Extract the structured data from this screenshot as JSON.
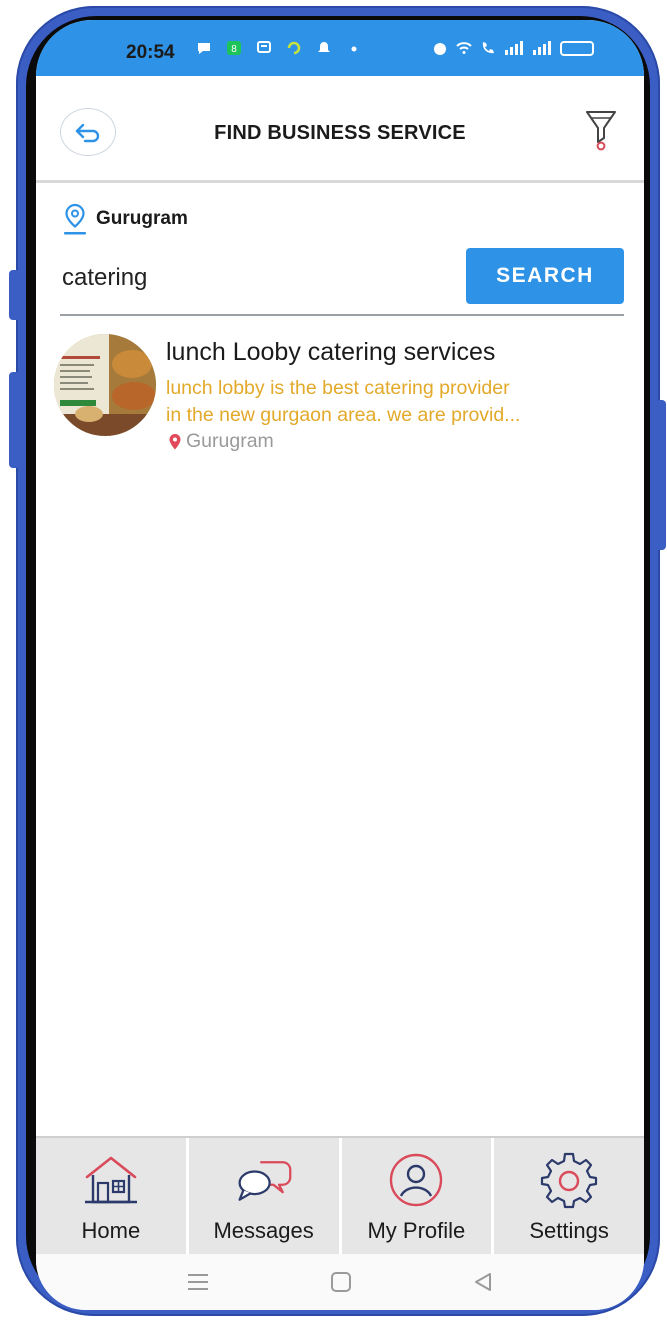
{
  "status_bar": {
    "time": "20:54"
  },
  "header": {
    "title": "FIND BUSINESS SERVICE",
    "back_icon": "back-arrow-icon",
    "filter_icon": "filter-icon"
  },
  "search": {
    "location": "Gurugram",
    "query": "catering",
    "button_label": "SEARCH"
  },
  "results": [
    {
      "title": "lunch Looby catering services",
      "description_line1": "lunch lobby is the best catering provider",
      "description_line2": "in the new gurgaon area. we are provid...",
      "location": "Gurugram"
    }
  ],
  "bottom_nav": {
    "items": [
      {
        "label": "Home",
        "icon": "home-icon"
      },
      {
        "label": "Messages",
        "icon": "messages-icon"
      },
      {
        "label": "My Profile",
        "icon": "profile-icon"
      },
      {
        "label": "Settings",
        "icon": "settings-icon"
      }
    ]
  },
  "colors": {
    "primary": "#2e93e6",
    "description": "#e3a92a",
    "frame": "#3a5ec4",
    "accent_red": "#d94a5a"
  }
}
